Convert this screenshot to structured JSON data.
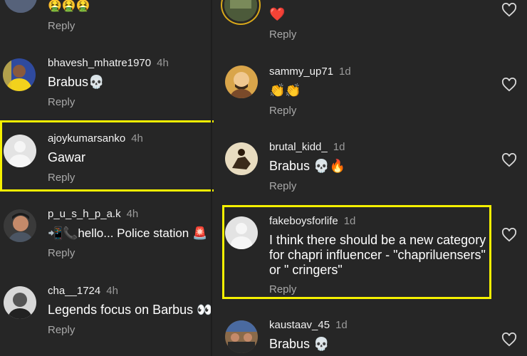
{
  "left_comments": [
    {
      "username": "",
      "time": "",
      "text": "🤮🤮🤮",
      "reply": "Reply",
      "avatar": "partial-avatar"
    },
    {
      "username": "bhavesh_mhatre1970",
      "time": "4h",
      "text": "Brabus💀",
      "reply": "Reply",
      "avatar": "team-jersey-avatar"
    },
    {
      "username": "ajoykumarsanko",
      "time": "4h",
      "text": "Gawar",
      "reply": "Reply",
      "avatar": "default-avatar"
    },
    {
      "username": "p_u_s_h_p_a.k",
      "time": "4h",
      "text": "📲📞hello... Police station 🚨",
      "reply": "Reply",
      "avatar": "selfie-avatar"
    },
    {
      "username": "cha__1724",
      "time": "4h",
      "text": "Legends focus on Barbus 👀",
      "reply": "Reply",
      "avatar": "bw-portrait-avatar"
    }
  ],
  "right_comments": [
    {
      "username": "",
      "time": "",
      "text": "❤️",
      "reply": "Reply",
      "avatar": "story-ring-avatar"
    },
    {
      "username": "sammy_up71",
      "time": "1d",
      "text": "👏👏",
      "reply": "Reply",
      "avatar": "cartoon-avatar"
    },
    {
      "username": "brutal_kidd_",
      "time": "1d",
      "text": "Brabus 💀🔥",
      "reply": "Reply",
      "avatar": "horse-rider-avatar"
    },
    {
      "username": "fakeboysforlife",
      "time": "1d",
      "text": "I think there should be a new category for chapri influencer - \"chapriluensers\" or \" cringers\"",
      "reply": "Reply",
      "avatar": "default-avatar"
    },
    {
      "username": "kaustaav_45",
      "time": "1d",
      "text": "Brabus 💀",
      "reply": "",
      "avatar": "group-photo-avatar"
    }
  ],
  "colors": {
    "highlight": "#f5f000",
    "background": "#262626",
    "meta": "#9a9a9a"
  },
  "icons": {
    "like": "heart-outline-icon"
  }
}
